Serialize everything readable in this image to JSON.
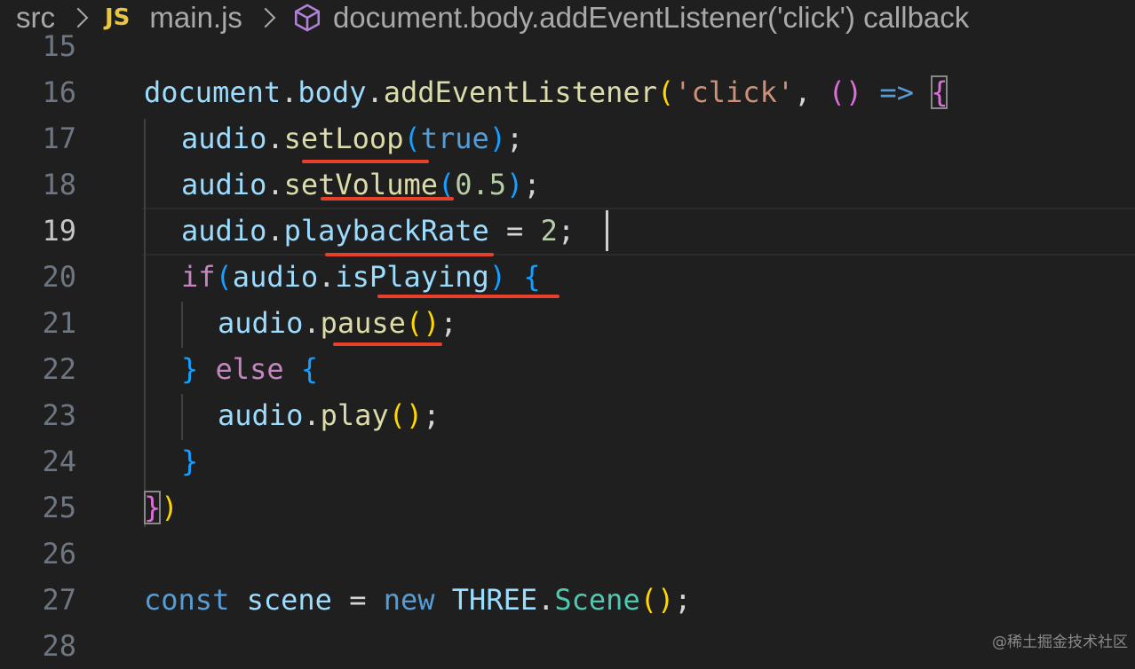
{
  "breadcrumb": {
    "items": [
      {
        "label": "src",
        "icon": null
      },
      {
        "label": "main.js",
        "icon": "js-file-icon",
        "icon_text": "JS"
      },
      {
        "label": "document.body.addEventListener('click') callback",
        "icon": "symbol-method-icon"
      }
    ]
  },
  "editor": {
    "line_numbers": [
      "15",
      "16",
      "17",
      "18",
      "19",
      "20",
      "21",
      "22",
      "23",
      "24",
      "25",
      "26",
      "27",
      "28"
    ],
    "active_line": "19",
    "tokens": {
      "l16": [
        "document",
        ".",
        "body",
        ".",
        "addEventListener",
        "(",
        "'click'",
        ", ",
        "(",
        ")",
        " ",
        "=>",
        " ",
        "{"
      ],
      "l17": [
        "audio",
        ".",
        "setLoop",
        "(",
        "true",
        ")",
        ";"
      ],
      "l18": [
        "audio",
        ".",
        "setVolume",
        "(",
        "0.5",
        ")",
        ";"
      ],
      "l19": [
        "audio",
        ".",
        "playbackRate",
        " = ",
        "2",
        ";"
      ],
      "l20": [
        "if",
        "(",
        "audio",
        ".",
        "isPlaying",
        ")",
        " ",
        "{"
      ],
      "l21": [
        "audio",
        ".",
        "pause",
        "(",
        ")",
        ";"
      ],
      "l22": [
        "}",
        " ",
        "else",
        " ",
        "{"
      ],
      "l23": [
        "audio",
        ".",
        "play",
        "(",
        ")",
        ";"
      ],
      "l24": [
        "}"
      ],
      "l25": [
        "}",
        ")"
      ],
      "l27": [
        "const",
        " ",
        "scene",
        " = ",
        "new",
        " ",
        "THREE",
        ".",
        "Scene",
        "(",
        ")",
        ";"
      ]
    },
    "annotation_color": "#e8402a"
  },
  "watermark": "@稀土掘金技术社区"
}
